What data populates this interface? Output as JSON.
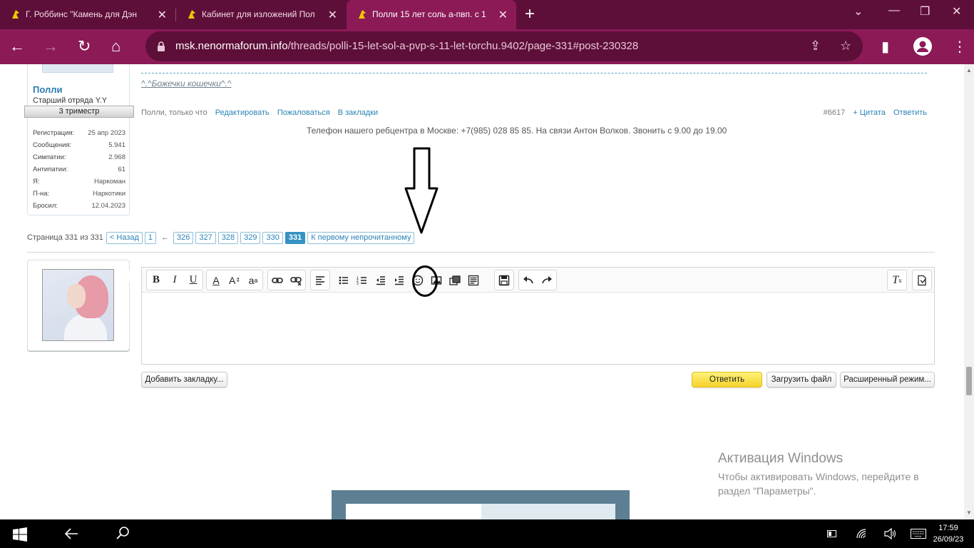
{
  "browser": {
    "tabs": [
      {
        "title": "Г. Роббинс \"Камень для Дэн",
        "active": false
      },
      {
        "title": "Кабинет для изложений Пол",
        "active": false
      },
      {
        "title": "Полли 15 лет соль а-пвп. с 1",
        "active": true
      }
    ],
    "url_domain": "msk.nenormaforum.info",
    "url_path": "/threads/polli-15-let-sol-a-pvp-s-11-let-torchu.9402/page-331#post-230328",
    "colors": {
      "frame": "#5e0f39",
      "toolbar": "#8c1a57"
    }
  },
  "post": {
    "username": "Полли",
    "user_title": "Старший отряда Y.Y",
    "ribbon": "3 триместр",
    "stats": [
      {
        "label": "Регистрация:",
        "value": "25 апр 2023"
      },
      {
        "label": "Сообщения:",
        "value": "5.941"
      },
      {
        "label": "Симпатии:",
        "value": "2.968"
      },
      {
        "label": "Антипатии:",
        "value": "61"
      },
      {
        "label": "Я:",
        "value": "Наркоман"
      },
      {
        "label": "П-на:",
        "value": "Наркотики"
      },
      {
        "label": "Бросил:",
        "value": "12.04.2023"
      }
    ],
    "signature": "^.^Божечки кошечки^.^",
    "meta_author": "Полли, только что",
    "edit_link": "Редактировать",
    "report_link": "Пожаловаться",
    "bookmark_link": "В закладки",
    "post_number": "#6617",
    "quote_link": "+ Цитата",
    "reply_link": "Ответить",
    "phone_notice": "Телефон нашего ребцентра в Москве: +7(985) 028 85 85. На связи Антон Волков. Звонить с 9.00 до 19.00"
  },
  "pagination": {
    "label": "Страница 331 из 331",
    "prev": "< Назад",
    "first": "1",
    "ellipsis": "←",
    "pages": [
      "326",
      "327",
      "328",
      "329",
      "330",
      "331"
    ],
    "current": "331",
    "unread": "К первому непрочитанному"
  },
  "quick_reply": {
    "bookmark_button": "Добавить закладку...",
    "reply_button": "Ответить",
    "upload_button": "Загрузить файл",
    "advanced_button": "Расширенный режим..."
  },
  "watermark": {
    "title": "Активация Windows",
    "text": "Чтобы активировать Windows, перейдите в раздел \"Параметры\"."
  },
  "taskbar": {
    "time": "17:59",
    "date": "26/09/23"
  }
}
